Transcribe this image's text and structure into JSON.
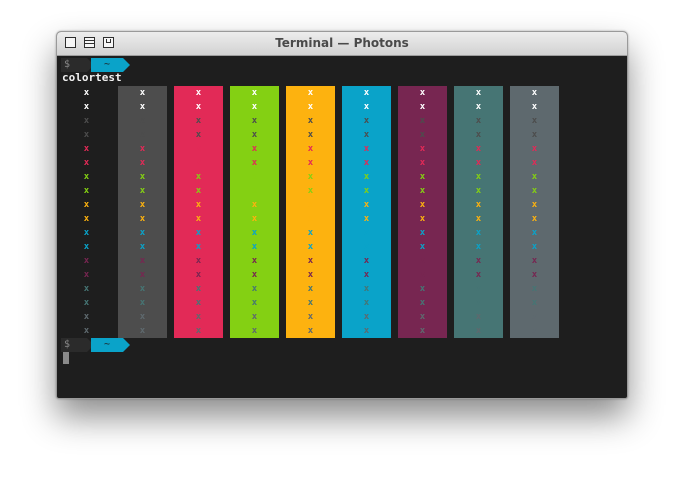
{
  "window": {
    "title": "Terminal — Photons"
  },
  "titlebar_icons": [
    "window-icon",
    "list-icon",
    "tray-icon"
  ],
  "prompt": {
    "dollar": "$",
    "path": "~"
  },
  "command": "colortest",
  "glyph": "x",
  "colors": {
    "terminal_bg": "#1e1e1e",
    "prompt_segment": "#0aa3c9",
    "white": "#ffffff",
    "gray": "#4d4d4d",
    "pink": "#e22a57",
    "green": "#84d013",
    "orange": "#fdb20f",
    "cyan": "#0aa3c9",
    "purple": "#772651",
    "teal": "#467574",
    "slate": "#5e696e"
  },
  "swatches": [
    "default",
    "gray",
    "pink",
    "green",
    "orange",
    "cyan",
    "purple",
    "teal",
    "slate"
  ],
  "rows": [
    "white",
    "white",
    "gray",
    "gray",
    "pink",
    "pink",
    "green",
    "green",
    "orange",
    "orange",
    "cyan",
    "cyan",
    "purple",
    "purple",
    "teal",
    "teal",
    "slate",
    "slate"
  ]
}
